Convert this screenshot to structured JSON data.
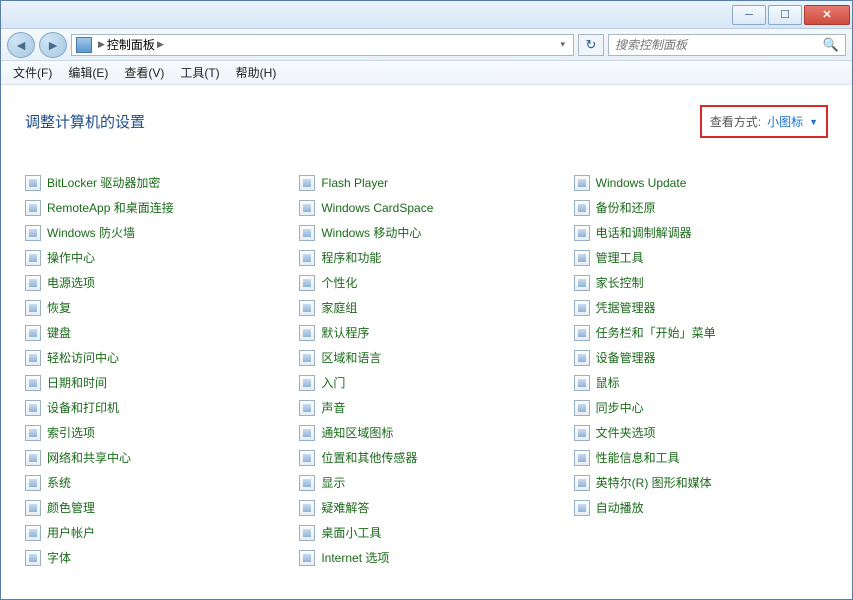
{
  "window": {
    "minimize": "─",
    "maximize": "☐",
    "close": "✕"
  },
  "address": {
    "location": "控制面板",
    "separator": "▶"
  },
  "search": {
    "placeholder": "搜索控制面板"
  },
  "menu": {
    "file": "文件(F)",
    "edit": "编辑(E)",
    "view": "查看(V)",
    "tools": "工具(T)",
    "help": "帮助(H)"
  },
  "heading": "调整计算机的设置",
  "viewby": {
    "label": "查看方式:",
    "value": "小图标",
    "arrow": "▼"
  },
  "items": [
    "BitLocker 驱动器加密",
    "RemoteApp 和桌面连接",
    "Windows 防火墙",
    "操作中心",
    "电源选项",
    "恢复",
    "键盘",
    "轻松访问中心",
    "日期和时间",
    "设备和打印机",
    "索引选项",
    "网络和共享中心",
    "系统",
    "颜色管理",
    "用户帐户",
    "字体",
    "Flash Player",
    "Windows CardSpace",
    "Windows 移动中心",
    "程序和功能",
    "个性化",
    "家庭组",
    "默认程序",
    "区域和语言",
    "入门",
    "声音",
    "通知区域图标",
    "位置和其他传感器",
    "显示",
    "疑难解答",
    "桌面小工具",
    "Internet 选项",
    "Windows Update",
    "备份和还原",
    "电话和调制解调器",
    "管理工具",
    "家长控制",
    "凭据管理器",
    "任务栏和「开始」菜单",
    "设备管理器",
    "鼠标",
    "同步中心",
    "文件夹选项",
    "性能信息和工具",
    "英特尔(R) 图形和媒体",
    "自动播放"
  ]
}
